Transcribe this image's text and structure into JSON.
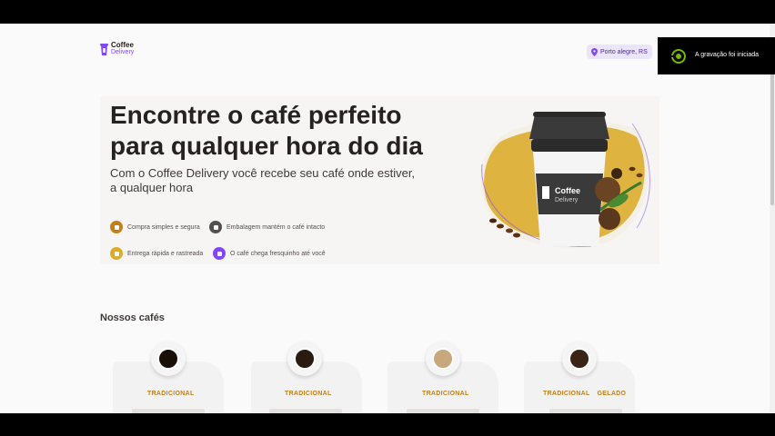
{
  "header": {
    "logo_line1": "Coffee",
    "logo_line2": "Delivery",
    "location": "Porto alegre, RS"
  },
  "hero": {
    "title": "Encontre o café perfeito para qualquer hora do dia",
    "subtitle": "Com o Coffee Delivery você recebe seu café onde estiver, a qualquer hora",
    "features": [
      {
        "label": "Compra simples e segura",
        "color": "#c47f17",
        "icon": "cart-icon"
      },
      {
        "label": "Embalagem mantém o café intacto",
        "color": "#574f4d",
        "icon": "package-icon"
      },
      {
        "label": "Entrega rápida e rastreada",
        "color": "#dbac2c",
        "icon": "timer-icon"
      },
      {
        "label": "O café chega fresquinho até você",
        "color": "#8047f8",
        "icon": "coffee-icon"
      }
    ],
    "cup_brand_line1": "Coffee",
    "cup_brand_line2": "Delivery"
  },
  "catalog": {
    "title": "Nossos cafés",
    "cards": [
      {
        "tags": [
          "TRADICIONAL"
        ],
        "coffee_color": "#1a0f08"
      },
      {
        "tags": [
          "TRADICIONAL"
        ],
        "coffee_color": "#2b1a10"
      },
      {
        "tags": [
          "TRADICIONAL"
        ],
        "coffee_color": "#c9a77c"
      },
      {
        "tags": [
          "TRADICIONAL",
          "GELADO"
        ],
        "coffee_color": "#3b2416"
      }
    ]
  },
  "toast": {
    "text": "A gravação foi iniciada"
  },
  "colors": {
    "brand_purple": "#8047f8",
    "brand_yellow": "#dbac2c",
    "brand_yellow_dark": "#c47f17"
  }
}
